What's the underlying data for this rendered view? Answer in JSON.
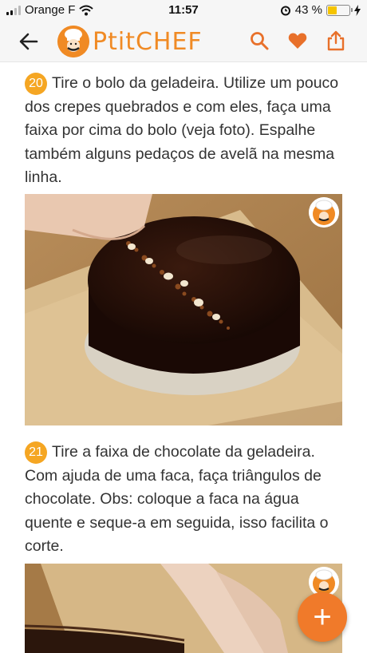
{
  "status": {
    "carrier": "Orange F",
    "time": "11:57",
    "battery": "43 %"
  },
  "header": {
    "brand": "PtitCHEF"
  },
  "steps": [
    {
      "number": "20",
      "text": "Tire o bolo da geladeira. Utilize um pouco dos crepes quebrados e com eles, faça uma faixa por cima do bolo (veja foto). Espalhe também alguns pedaços de avelã na mesma linha."
    },
    {
      "number": "21",
      "text": "Tire a faixa de chocolate da geladeira. Com ajuda de uma faca, faça triângulos de chocolate. Obs: coloque a faca na água quente e seque-a em seguida, isso facilita o corte."
    }
  ],
  "fab": {
    "label": "+"
  },
  "colors": {
    "accent": "#f08a24",
    "step_badge": "#f5a623",
    "fab": "#f07a2a"
  },
  "icons": [
    "signal-icon",
    "wifi-icon",
    "alarm-icon",
    "battery-icon",
    "back-arrow-icon",
    "ptitchef-logo-icon",
    "search-icon",
    "heart-icon",
    "share-icon",
    "plus-icon"
  ]
}
